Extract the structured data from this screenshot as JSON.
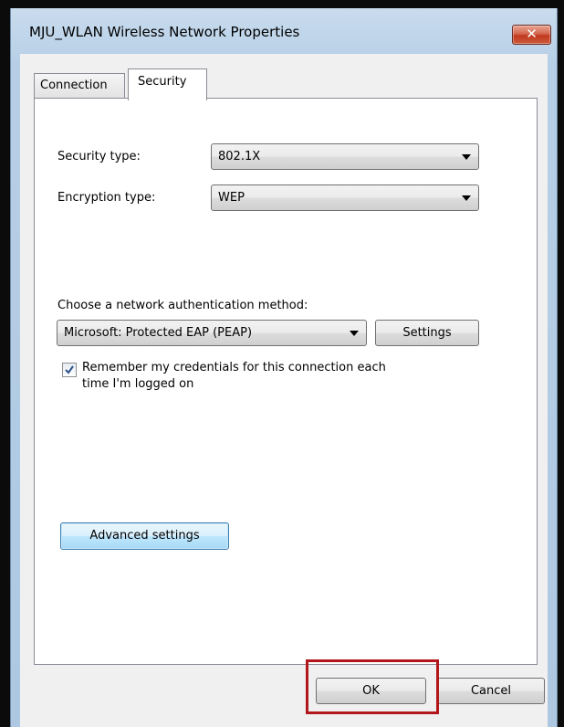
{
  "window": {
    "title": "MJU_WLAN Wireless Network Properties",
    "close_glyph": "✕"
  },
  "tabs": [
    {
      "label": "Connection",
      "selected": false
    },
    {
      "label": "Security",
      "selected": true
    }
  ],
  "security": {
    "security_type_label": "Security type:",
    "security_type_value": "802.1X",
    "encryption_type_label": "Encryption type:",
    "encryption_type_value": "WEP",
    "auth_method_label": "Choose a network authentication method:",
    "auth_method_value": "Microsoft: Protected EAP (PEAP)",
    "settings_label": "Settings",
    "remember_checked": true,
    "remember_line1": "Remember my credentials for this connection each",
    "remember_line2": "time I'm logged on",
    "advanced_label": "Advanced settings"
  },
  "footer": {
    "ok_label": "OK",
    "cancel_label": "Cancel"
  },
  "colors": {
    "highlight_box": "#b2171b",
    "close_button": "#c0391f"
  }
}
